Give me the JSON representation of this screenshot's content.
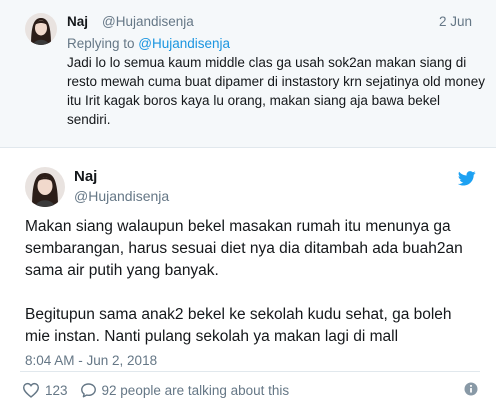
{
  "parent_tweet": {
    "name": "Naj",
    "handle": "@Hujandisenja",
    "date": "2 Jun",
    "replying_prefix": "Replying to ",
    "replying_handle": "@Hujandisenja",
    "text": "Jadi lo lo semua kaum middle clas ga usah sok2an makan siang di resto mewah cuma buat dipamer di instastory krn sejatinya old money itu Irit kagak boros kaya lu orang, makan siang aja bawa bekel sendiri."
  },
  "tweet": {
    "name": "Naj",
    "handle": "@Hujandisenja",
    "paragraphs": [
      "Makan siang walaupun bekel masakan rumah itu menunya ga sembarangan, harus sesuai diet nya dia ditambah ada buah2an sama air putih yang banyak.",
      "Begitupun sama anak2 bekel ke sekolah kudu sehat, ga boleh mie instan. Nanti pulang sekolah ya makan lagi di mall"
    ],
    "timestamp": "8:04 AM - Jun 2, 2018",
    "likes": "123",
    "talking": "92 people are talking about this"
  },
  "icons": {
    "brand": "twitter-bird-icon",
    "like": "heart-icon",
    "reply": "speech-bubble-icon",
    "info": "info-icon"
  },
  "colors": {
    "twitter_blue": "#1da1f2",
    "link_blue": "#1b95e0",
    "muted": "#657786",
    "parent_bg": "#f5f8fa"
  }
}
